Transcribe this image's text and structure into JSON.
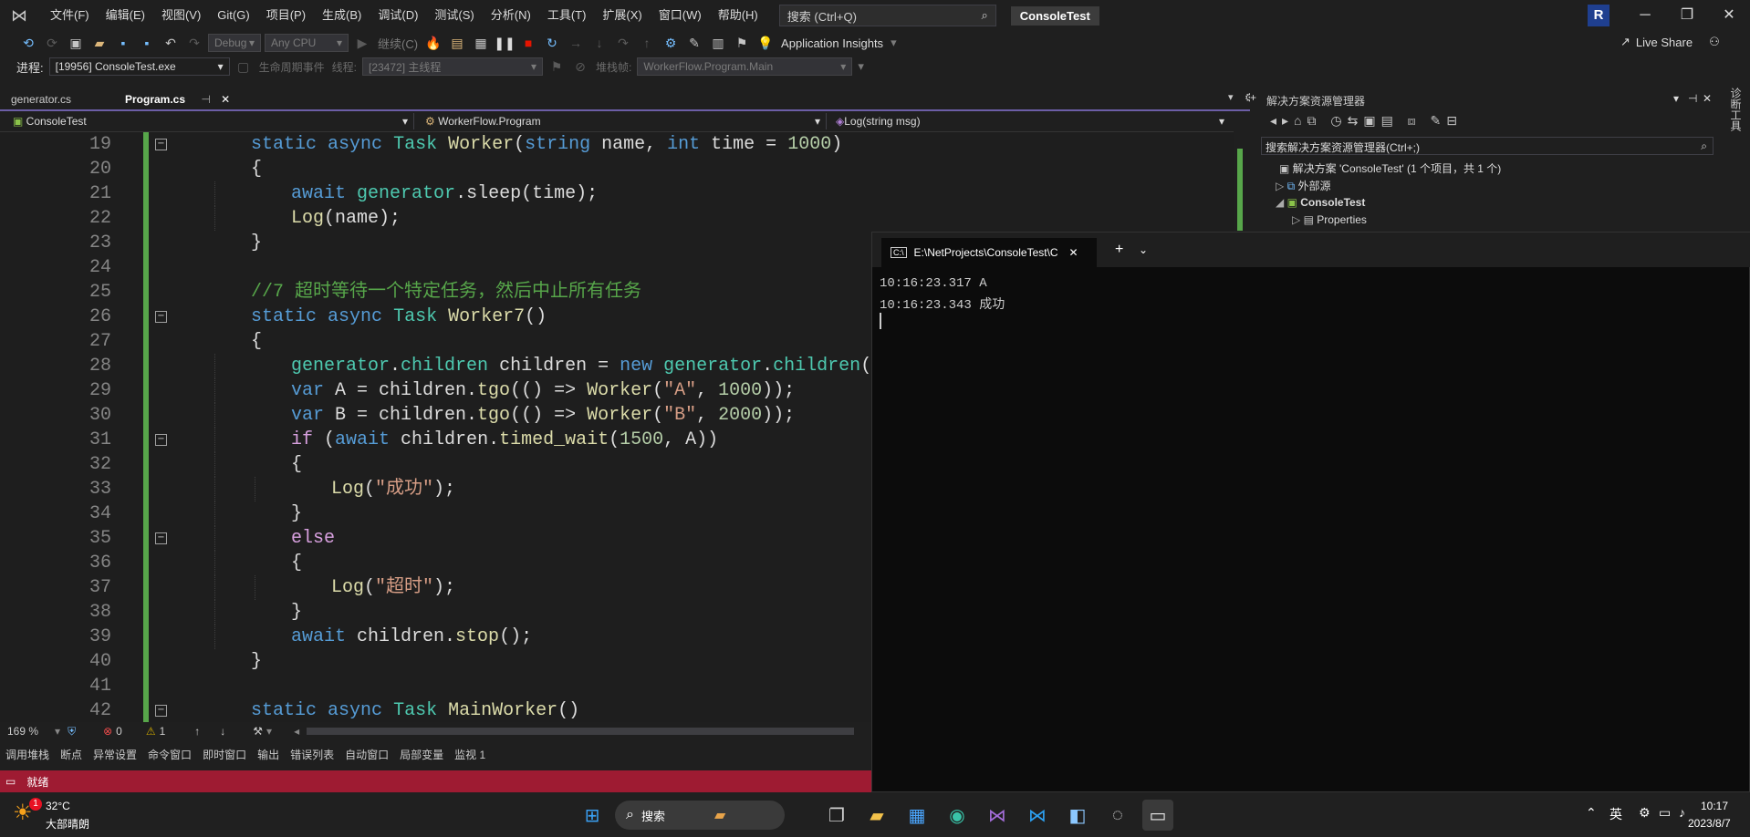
{
  "menu": {
    "items": [
      "文件(F)",
      "编辑(E)",
      "视图(V)",
      "Git(G)",
      "项目(P)",
      "生成(B)",
      "调试(D)",
      "测试(S)",
      "分析(N)",
      "工具(T)",
      "扩展(X)",
      "窗口(W)",
      "帮助(H)"
    ],
    "search_placeholder": "搜索 (Ctrl+Q)",
    "solution_name": "ConsoleTest",
    "user_initial": "R"
  },
  "toolbar": {
    "config": "Debug",
    "platform": "Any CPU",
    "continue_label": "继续(C)",
    "app_insights": "Application Insights",
    "live_share": "Live Share",
    "process_label": "进程:",
    "process_value": "[19956] ConsoleTest.exe",
    "lifecycle_label": "生命周期事件",
    "thread_label": "线程:",
    "thread_value": "[23472] 主线程",
    "stackframe_label": "堆栈帧:",
    "stackframe_value": "WorkerFlow.Program.Main"
  },
  "tabs": [
    {
      "label": "generator.cs"
    },
    {
      "label": "Program.cs"
    }
  ],
  "navbar": {
    "project": "ConsoleTest",
    "class": "WorkerFlow.Program",
    "member": "Log(string msg)"
  },
  "code_lines": [
    {
      "n": "19",
      "indent": 1
    },
    {
      "n": "20",
      "indent": 1
    },
    {
      "n": "21",
      "indent": 2
    },
    {
      "n": "22",
      "indent": 2
    },
    {
      "n": "23",
      "indent": 1
    },
    {
      "n": "24",
      "indent": 0
    },
    {
      "n": "25",
      "indent": 1
    },
    {
      "n": "26",
      "indent": 1
    },
    {
      "n": "27",
      "indent": 1
    },
    {
      "n": "28",
      "indent": 2
    },
    {
      "n": "29",
      "indent": 2
    },
    {
      "n": "30",
      "indent": 2
    },
    {
      "n": "31",
      "indent": 2
    },
    {
      "n": "32",
      "indent": 2
    },
    {
      "n": "33",
      "indent": 3
    },
    {
      "n": "34",
      "indent": 2
    },
    {
      "n": "35",
      "indent": 2
    },
    {
      "n": "36",
      "indent": 2
    },
    {
      "n": "37",
      "indent": 3
    },
    {
      "n": "38",
      "indent": 2
    },
    {
      "n": "39",
      "indent": 2
    },
    {
      "n": "40",
      "indent": 1
    },
    {
      "n": "41",
      "indent": 0
    },
    {
      "n": "42",
      "indent": 1
    }
  ],
  "code_text": {
    "l19": [
      "static",
      " ",
      "async",
      " ",
      "Task",
      " ",
      "Worker",
      "(",
      "string",
      " name, ",
      "int",
      " time = ",
      "1000",
      ")"
    ],
    "l20": "{",
    "l21": [
      "await",
      " ",
      "generator",
      ".sleep(time);"
    ],
    "l22": [
      "Log",
      "(name);"
    ],
    "l23": "}",
    "l25": "//7 超时等待一个特定任务，然后中止所有任务",
    "l26": [
      "static",
      " ",
      "async",
      " ",
      "Task",
      " ",
      "Worker7",
      "()"
    ],
    "l27": "{",
    "l28": [
      "generator",
      ".",
      "children",
      " children = ",
      "new",
      " ",
      "generator",
      ".",
      "children",
      "();"
    ],
    "l29": [
      "var",
      " A = children.",
      "tgo",
      "(() => ",
      "Worker",
      "(",
      "\"A\"",
      ", ",
      "1000",
      "));"
    ],
    "l30": [
      "var",
      " B = children.",
      "tgo",
      "(() => ",
      "Worker",
      "(",
      "\"B\"",
      ", ",
      "2000",
      "));"
    ],
    "l31": [
      "if",
      " (",
      "await",
      " children.",
      "timed_wait",
      "(",
      "1500",
      ", A))"
    ],
    "l32": "{",
    "l33": [
      "Log",
      "(",
      "\"成功\"",
      ");"
    ],
    "l34": "}",
    "l35": [
      "else"
    ],
    "l36": "{",
    "l37": [
      "Log",
      "(",
      "\"超时\"",
      ");"
    ],
    "l38": "}",
    "l39": [
      "await",
      " children.",
      "stop",
      "();"
    ],
    "l40": "}",
    "l42": [
      "static",
      " ",
      "async",
      " ",
      "Task",
      " ",
      "MainWorker",
      "()"
    ]
  },
  "editor_status": {
    "zoom": "169 %",
    "errors": "0",
    "warnings": "1"
  },
  "bottom_tabs": [
    "调用堆栈",
    "断点",
    "异常设置",
    "命令窗口",
    "即时窗口",
    "输出",
    "错误列表",
    "自动窗口",
    "局部变量",
    "监视 1"
  ],
  "status": {
    "text": "就绪"
  },
  "solution_explorer": {
    "title": "解决方案资源管理器",
    "search_placeholder": "搜索解决方案资源管理器(Ctrl+;)",
    "items": [
      {
        "label": "解决方案 'ConsoleTest' (1 个项目，共 1 个)"
      },
      {
        "label": "外部源"
      },
      {
        "label": "ConsoleTest"
      },
      {
        "label": "Properties"
      }
    ]
  },
  "terminal": {
    "tab_title": "E:\\NetProjects\\ConsoleTest\\C",
    "lines": [
      "10:16:23.317 A",
      "10:16:23.343 成功"
    ]
  },
  "right_strip_label": "诊断工具",
  "taskbar": {
    "weather_temp": "32°C",
    "weather_desc": "大部晴朗",
    "weather_badge": "1",
    "search_label": "搜索",
    "ime": "英",
    "time": "10:17",
    "date": "2023/8/7"
  }
}
